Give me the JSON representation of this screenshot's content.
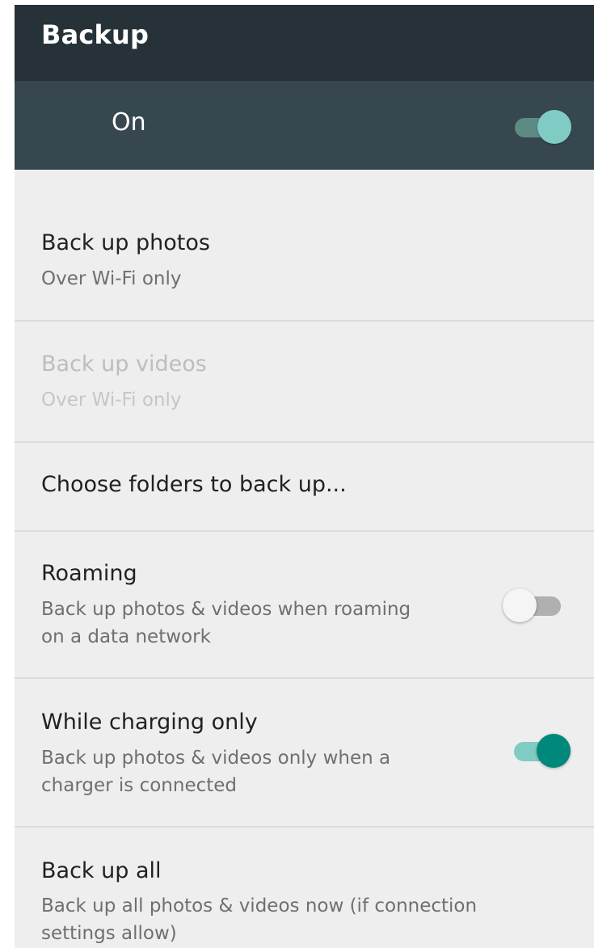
{
  "toolbar": {
    "title": "Backup"
  },
  "master": {
    "label": "On",
    "enabled": true
  },
  "items": [
    {
      "title": "Back up photos",
      "summary": "Over Wi-Fi only",
      "enabled": true
    },
    {
      "title": "Back up videos",
      "summary": "Over Wi-Fi only",
      "enabled": false
    },
    {
      "title": "Choose folders to back up..."
    },
    {
      "title": "Roaming",
      "summary_line1": "Back up photos & videos when roaming",
      "summary_line2": "on a data network",
      "toggle": false
    },
    {
      "title": "While charging only",
      "summary_line1": "Back up photos & videos only when a",
      "summary_line2": "charger is connected",
      "toggle": true
    },
    {
      "title": "Back up all",
      "summary_line1": "Back up all photos & videos now (if connection",
      "summary_line2": "settings allow)"
    }
  ],
  "colors": {
    "toolbar": "#263238",
    "master_bar": "#37474f",
    "background": "#eeeeee",
    "accent": "#00897b"
  },
  "icons": {
    "master_switch": "toggle-on-icon",
    "roaming_switch": "toggle-off-icon",
    "charging_switch": "toggle-on-icon"
  }
}
